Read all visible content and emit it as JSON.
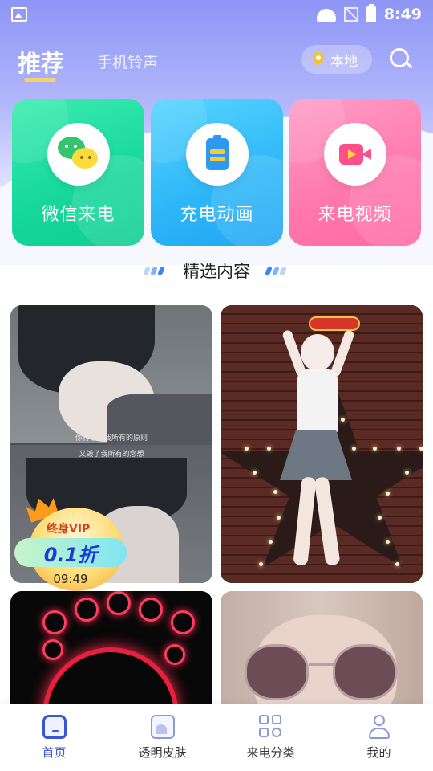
{
  "status_bar": {
    "time": "8:49"
  },
  "header": {
    "tab_recommend": "推荐",
    "tab_ringtone": "手机铃声",
    "location_label": "本地"
  },
  "feature_cards": [
    {
      "label": "微信来电",
      "icon": "wechat-icon"
    },
    {
      "label": "充电动画",
      "icon": "battery-icon"
    },
    {
      "label": "来电视频",
      "icon": "video-icon"
    }
  ],
  "section": {
    "title": "精选内容"
  },
  "tiles": [
    {
      "caption_line1": "你打破了我所有的原则",
      "caption_line2": "又毁了我所有的念想"
    }
  ],
  "vip_badge": {
    "top_text": "终身VIP",
    "discount": "0.1折",
    "countdown": "09:49"
  },
  "bottom_nav": [
    {
      "label": "首页",
      "icon": "home-icon",
      "active": true
    },
    {
      "label": "透明皮肤",
      "icon": "skin-icon",
      "active": false
    },
    {
      "label": "来电分类",
      "icon": "category-icon",
      "active": false
    },
    {
      "label": "我的",
      "icon": "profile-icon",
      "active": false
    }
  ],
  "colors": {
    "accent": "#3a54d8",
    "wechat_card": "#16d79a",
    "charge_card": "#2db6f7",
    "video_card": "#ff77ab",
    "tab_indicator": "#f5d36a"
  }
}
